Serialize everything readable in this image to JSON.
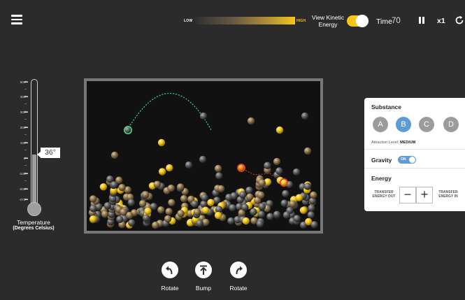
{
  "header": {
    "kinetic_low": "LOW",
    "kinetic_high": "HIGH",
    "view_kinetic_label_line1": "View Kinetic",
    "view_kinetic_label_line2": "Energy",
    "view_kinetic_on": true,
    "time_label": "Time",
    "time_value": "70",
    "speed": "x1"
  },
  "thermometer": {
    "ticks": [
      "500°",
      "400°",
      "300°",
      "200°",
      "100°",
      "0°",
      "-100°",
      "-200°",
      "-273°"
    ],
    "temperature": "36°",
    "title": "Temperature",
    "subtitle": "(Degrees Celsius)"
  },
  "panel": {
    "substance_title": "Substance",
    "substances": [
      "A",
      "B",
      "C",
      "D"
    ],
    "selected_substance": "B",
    "attraction_label": "Attraction Level:",
    "attraction_value": "MEDIUM",
    "gravity_label": "Gravity",
    "gravity_state": "ON",
    "energy_title": "Energy",
    "transfer_out_line1": "TRANSFER",
    "transfer_out_line2": "ENERGY OUT",
    "transfer_in_line1": "TRANSFER",
    "transfer_in_line2": "ENERGY IN",
    "minus": "−",
    "plus": "+"
  },
  "controls": {
    "rotate_left_label": "Rotate",
    "bump_label": "Bump",
    "rotate_right_label": "Rotate"
  },
  "colors": {
    "background": "#2b2b2b",
    "accent_yellow": "#f5c518",
    "selected_blue": "#5c9bd5",
    "tracked_green": "#3ddc84",
    "tracked_red": "#e53935"
  }
}
